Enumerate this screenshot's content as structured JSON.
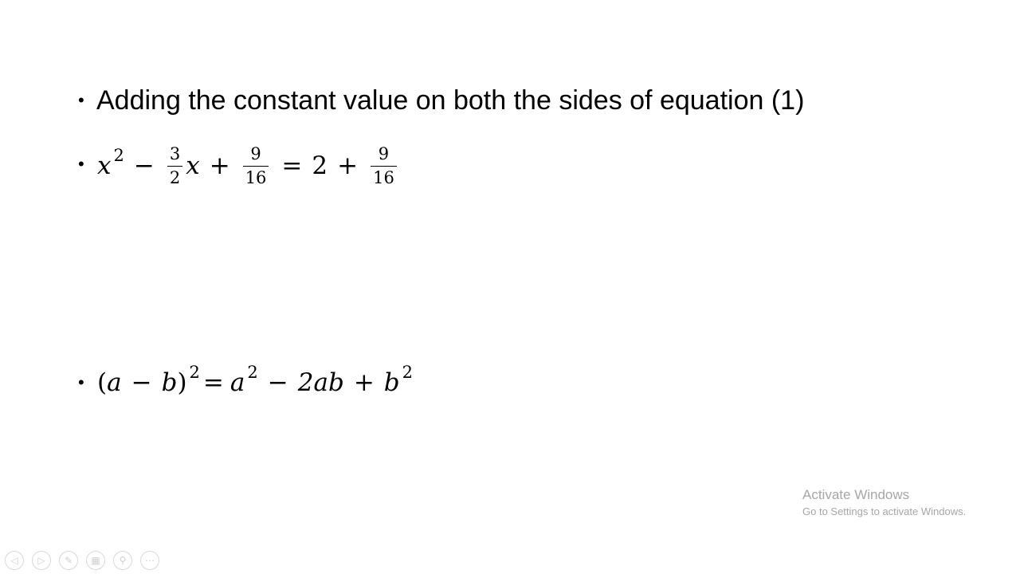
{
  "slide": {
    "bullet_glyph": "•",
    "text_bullet": "Adding the constant value on both the sides of equation (1)",
    "equation_1": {
      "x": "x",
      "exp": "2",
      "minus": "−",
      "f1_num": "3",
      "f1_den": "2",
      "x2": "x",
      "plus": "+",
      "f2_num": "9",
      "f2_den": "16",
      "equals": "=",
      "two": "2",
      "plus2": "+",
      "f3_num": "9",
      "f3_den": "16"
    },
    "equation_2": {
      "lhs_open": "(",
      "a": "a",
      "minus": "−",
      "b": "b",
      "lhs_close": ")",
      "lhs_exp": "2",
      "equals": "=",
      "a2": "a",
      "a2_exp": "2",
      "minus2": "−",
      "two_ab": "2ab",
      "plus": "+",
      "b2": "b",
      "b2_exp": "2"
    }
  },
  "watermark": {
    "title": "Activate Windows",
    "subtitle": "Go to Settings to activate Windows."
  },
  "toolbar": {
    "buttons": [
      "previous-icon",
      "next-icon",
      "pen-icon",
      "slides-grid-icon",
      "zoom-icon",
      "more-icon"
    ],
    "glyphs": [
      "◁",
      "▷",
      "✎",
      "▦",
      "⚲",
      "⋯"
    ]
  }
}
